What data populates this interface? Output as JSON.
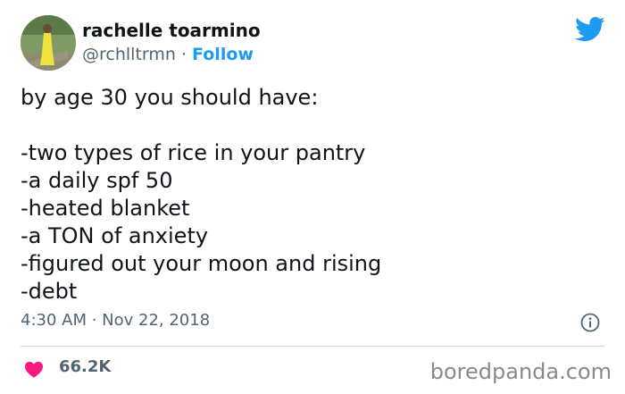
{
  "author": {
    "name": "rachelle toarmino",
    "handle": "@rchlltrmn",
    "separator": " · ",
    "follow_label": "Follow"
  },
  "tweet": {
    "lines": [
      "by age 30 you should have:",
      "",
      "-two types of rice in your pantry",
      "-a daily spf 50",
      "-heated blanket",
      "-a TON of anxiety",
      "-figured out your moon and rising",
      "-debt"
    ],
    "timestamp": "4:30 AM · Nov 22, 2018",
    "likes": "66.2K"
  },
  "watermark": "boredpanda.com",
  "icons": {
    "brand": "twitter-bird-icon",
    "info": "info-icon",
    "like": "heart-icon"
  },
  "colors": {
    "twitter_blue": "#1d9bf0",
    "heart_red": "#f91880",
    "muted_text": "#536471",
    "divider": "#cfd9de"
  }
}
